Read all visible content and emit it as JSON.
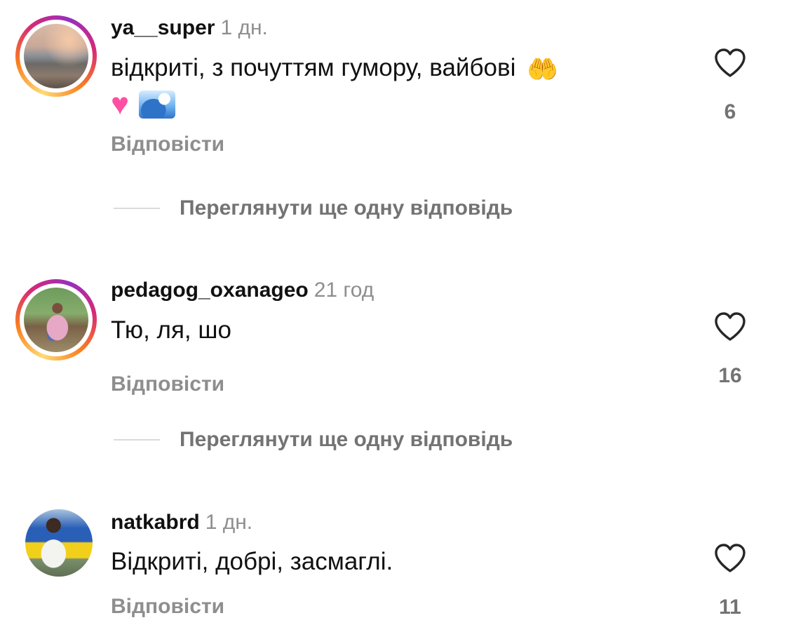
{
  "comments": [
    {
      "username": "ya__super",
      "time": "1 дн.",
      "text": "відкриті, з почуттям гумору, вайбові",
      "emojis": [
        "raising-hands-emoji",
        "pink-heart-emoji",
        "water-wave-emoji"
      ],
      "reply_label": "Відповісти",
      "likes": "6",
      "view_replies_label": "Переглянути ще одну відповідь",
      "has_story_ring": true
    },
    {
      "username": "pedagog_oxanageo",
      "time": "21 год",
      "text": "Тю, ля, шо",
      "reply_label": "Відповісти",
      "likes": "16",
      "view_replies_label": "Переглянути ще одну відповідь",
      "has_story_ring": true
    },
    {
      "username": "natkabrd",
      "time": "1 дн.",
      "text": "Відкриті, добрі, засмаглі.",
      "reply_label": "Відповісти",
      "likes": "11",
      "has_story_ring": false
    }
  ],
  "icons": {
    "like": "heart-outline-icon"
  },
  "colors": {
    "secondary_text": "#8e8e8e",
    "primary_text": "#111111",
    "divider": "#dbdbdb"
  }
}
